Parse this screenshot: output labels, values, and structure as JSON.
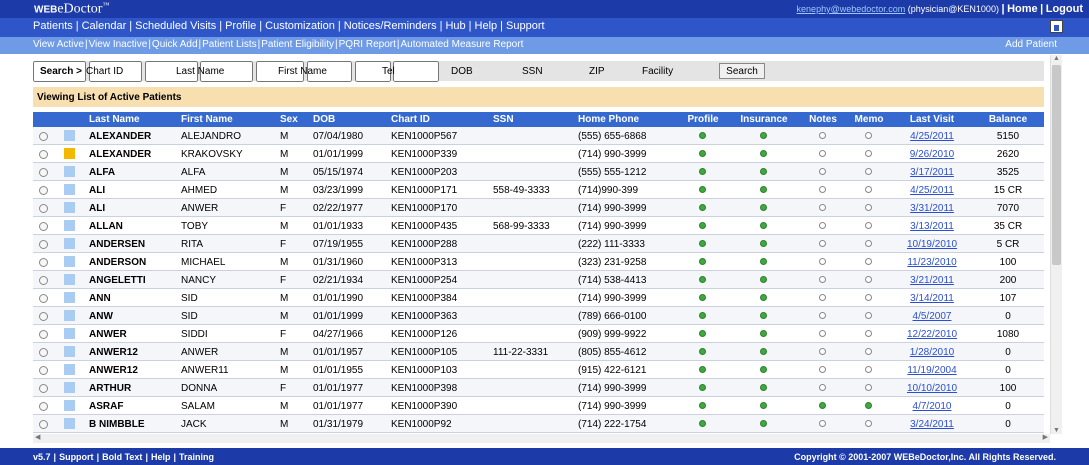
{
  "header": {
    "logo_prefix": "WEB",
    "logo_main": "eDoctor",
    "logo_tm": "™",
    "user_email": "kenephy@webedoctor.com",
    "user_role": "(physician@KEN1000)",
    "home_label": "Home",
    "logout_label": "Logout",
    "separator": "|"
  },
  "main_nav": {
    "items": [
      "Patients",
      "Calendar",
      "Scheduled Visits",
      "Profile",
      "Customization",
      "Notices/Reminders",
      "Hub",
      "Help",
      "Support"
    ]
  },
  "sub_nav": {
    "items": [
      "View Active",
      "View Inactive",
      "Quick Add",
      "Patient Lists",
      "Patient Eligibility",
      "PQRI Report",
      "Automated Measure Report"
    ],
    "add_patient": "Add Patient"
  },
  "search": {
    "label": "Search >",
    "fields": [
      "Chart ID",
      "Last Name",
      "First Name",
      "Tel",
      "DOB",
      "SSN",
      "ZIP",
      "Facility"
    ],
    "button": "Search"
  },
  "viewing_label": "Viewing List of Active Patients",
  "table": {
    "columns": [
      "Last Name",
      "First Name",
      "Sex",
      "DOB",
      "Chart ID",
      "SSN",
      "Home Phone",
      "Profile",
      "Insurance",
      "Notes",
      "Memo",
      "Last Visit",
      "Balance"
    ],
    "rows": [
      {
        "last": "ALEXANDER",
        "first": "ALEJANDRO",
        "sex": "M",
        "dob": "07/04/1980",
        "chart": "KEN1000P567",
        "ssn": "",
        "phone": "(555) 655-6868",
        "profile": true,
        "insurance": true,
        "notes": false,
        "memo": false,
        "visit": "4/25/2011",
        "balance": "5150",
        "flag": "blue"
      },
      {
        "last": "ALEXANDER",
        "first": "KRAKOVSKY",
        "sex": "M",
        "dob": "01/01/1999",
        "chart": "KEN1000P339",
        "ssn": "",
        "phone": "(714) 990-3999",
        "profile": true,
        "insurance": true,
        "notes": false,
        "memo": false,
        "visit": "9/26/2010",
        "balance": "2620",
        "flag": "yellow"
      },
      {
        "last": "ALFA",
        "first": "ALFA",
        "sex": "M",
        "dob": "05/15/1974",
        "chart": "KEN1000P203",
        "ssn": "",
        "phone": "(555) 555-1212",
        "profile": true,
        "insurance": true,
        "notes": false,
        "memo": false,
        "visit": "3/17/2011",
        "balance": "3525",
        "flag": "blue"
      },
      {
        "last": "ALI",
        "first": "AHMED",
        "sex": "M",
        "dob": "03/23/1999",
        "chart": "KEN1000P171",
        "ssn": "558-49-3333",
        "phone": "(714)990-399",
        "profile": true,
        "insurance": true,
        "notes": false,
        "memo": false,
        "visit": "4/25/2011",
        "balance": "15 CR",
        "flag": "blue"
      },
      {
        "last": "ALI",
        "first": "ANWER",
        "sex": "F",
        "dob": "02/22/1977",
        "chart": "KEN1000P170",
        "ssn": "",
        "phone": "(714) 990-3999",
        "profile": true,
        "insurance": true,
        "notes": false,
        "memo": false,
        "visit": "3/31/2011",
        "balance": "7070",
        "flag": "blue"
      },
      {
        "last": "ALLAN",
        "first": "TOBY",
        "sex": "M",
        "dob": "01/01/1933",
        "chart": "KEN1000P435",
        "ssn": "568-99-3333",
        "phone": "(714) 990-3999",
        "profile": true,
        "insurance": true,
        "notes": false,
        "memo": false,
        "visit": "3/13/2011",
        "balance": "35 CR",
        "flag": "blue"
      },
      {
        "last": "ANDERSEN",
        "first": "RITA",
        "sex": "F",
        "dob": "07/19/1955",
        "chart": "KEN1000P288",
        "ssn": "",
        "phone": "(222) 111-3333",
        "profile": true,
        "insurance": true,
        "notes": false,
        "memo": false,
        "visit": "10/19/2010",
        "balance": "5 CR",
        "flag": "blue"
      },
      {
        "last": "ANDERSON",
        "first": "MICHAEL",
        "sex": "M",
        "dob": "01/31/1960",
        "chart": "KEN1000P313",
        "ssn": "",
        "phone": "(323) 231-9258",
        "profile": true,
        "insurance": true,
        "notes": false,
        "memo": false,
        "visit": "11/23/2010",
        "balance": "100",
        "flag": "blue"
      },
      {
        "last": "ANGELETTI",
        "first": "NANCY",
        "sex": "F",
        "dob": "02/21/1934",
        "chart": "KEN1000P254",
        "ssn": "",
        "phone": "(714) 538-4413",
        "profile": true,
        "insurance": true,
        "notes": false,
        "memo": false,
        "visit": "3/21/2011",
        "balance": "200",
        "flag": "blue"
      },
      {
        "last": "ANN",
        "first": "SID",
        "sex": "M",
        "dob": "01/01/1990",
        "chart": "KEN1000P384",
        "ssn": "",
        "phone": "(714) 990-3999",
        "profile": true,
        "insurance": true,
        "notes": false,
        "memo": false,
        "visit": "3/14/2011",
        "balance": "107",
        "flag": "blue"
      },
      {
        "last": "ANW",
        "first": "SID",
        "sex": "M",
        "dob": "01/01/1999",
        "chart": "KEN1000P363",
        "ssn": "",
        "phone": "(789) 666-0100",
        "profile": true,
        "insurance": true,
        "notes": false,
        "memo": false,
        "visit": "4/5/2007",
        "balance": "0",
        "flag": "blue"
      },
      {
        "last": "ANWER",
        "first": "SIDDI",
        "sex": "F",
        "dob": "04/27/1966",
        "chart": "KEN1000P126",
        "ssn": "",
        "phone": "(909) 999-9922",
        "profile": true,
        "insurance": true,
        "notes": false,
        "memo": false,
        "visit": "12/22/2010",
        "balance": "1080",
        "flag": "blue"
      },
      {
        "last": "ANWER12",
        "first": "ANWER",
        "sex": "M",
        "dob": "01/01/1957",
        "chart": "KEN1000P105",
        "ssn": "111-22-3331",
        "phone": "(805) 855-4612",
        "profile": true,
        "insurance": true,
        "notes": false,
        "memo": false,
        "visit": "1/28/2010",
        "balance": "0",
        "flag": "blue"
      },
      {
        "last": "ANWER12",
        "first": "ANWER11",
        "sex": "M",
        "dob": "01/01/1955",
        "chart": "KEN1000P103",
        "ssn": "",
        "phone": "(915) 422-6121",
        "profile": true,
        "insurance": true,
        "notes": false,
        "memo": false,
        "visit": "11/19/2004",
        "balance": "0",
        "flag": "blue"
      },
      {
        "last": "ARTHUR",
        "first": "DONNA",
        "sex": "F",
        "dob": "01/01/1977",
        "chart": "KEN1000P398",
        "ssn": "",
        "phone": "(714) 990-3999",
        "profile": true,
        "insurance": true,
        "notes": false,
        "memo": false,
        "visit": "10/10/2010",
        "balance": "100",
        "flag": "blue"
      },
      {
        "last": "ASRAF",
        "first": "SALAM",
        "sex": "M",
        "dob": "01/01/1977",
        "chart": "KEN1000P390",
        "ssn": "",
        "phone": "(714) 990-3999",
        "profile": true,
        "insurance": true,
        "notes": true,
        "memo": true,
        "visit": "4/7/2010",
        "balance": "0",
        "flag": "blue"
      },
      {
        "last": "B NIMBBLE",
        "first": "JACK",
        "sex": "M",
        "dob": "01/31/1979",
        "chart": "KEN1000P92",
        "ssn": "",
        "phone": "(714) 222-1754",
        "profile": true,
        "insurance": true,
        "notes": false,
        "memo": false,
        "visit": "3/24/2011",
        "balance": "0",
        "flag": "blue"
      }
    ]
  },
  "footer": {
    "left_items": [
      "v5.7",
      "Support",
      "Bold Text",
      "Help",
      "Training"
    ],
    "copyright": "Copyright © 2001-2007 WEBeDoctor,Inc. All Rights Reserved."
  },
  "colors": {
    "header_bg": "#1c3aa8",
    "nav_bg": "#2f56c8",
    "subnav_bg": "#6e9ae6",
    "table_header_bg": "#3569cf",
    "viewing_bg": "#f7dfb0",
    "status_on": "#3ea93e",
    "flag_yellow": "#f3b800",
    "flag_blue": "#a9cdf2"
  }
}
